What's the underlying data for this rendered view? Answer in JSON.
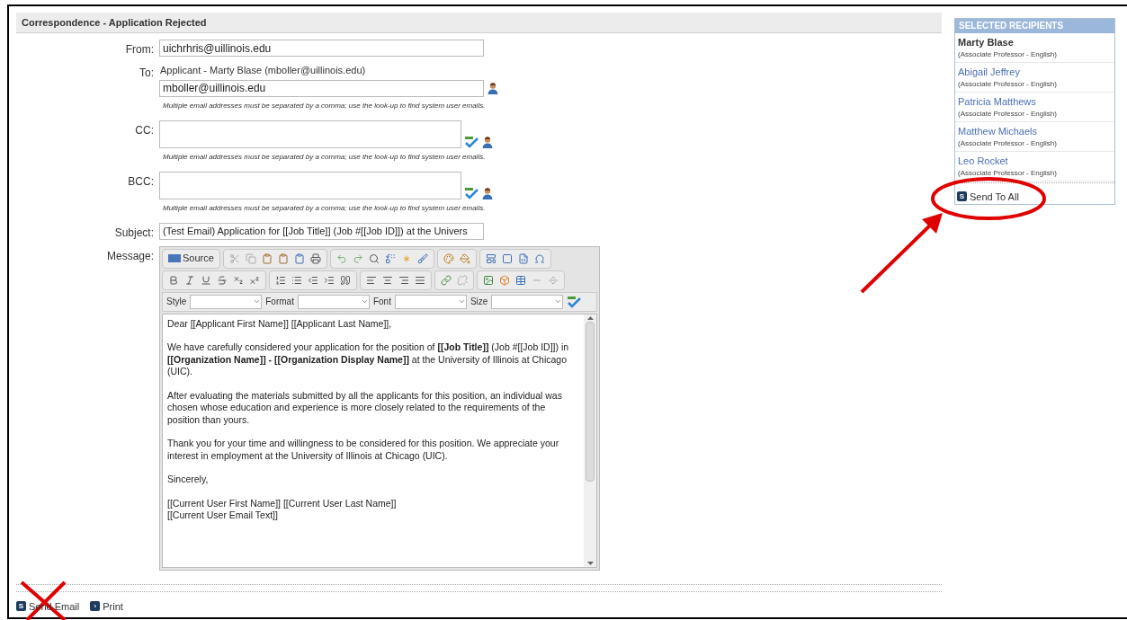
{
  "panel_title": "Correspondence - Application Rejected",
  "form": {
    "from": {
      "label": "From:",
      "value": "uichrhris@uillinois.edu"
    },
    "to": {
      "label": "To:",
      "recipient": "Applicant - Marty Blase (mboller@uillinois.edu)",
      "value": "mboller@uillinois.edu",
      "hint": "Multiple email addresses must be separated by a comma; use the look-up to find system user emails."
    },
    "cc": {
      "label": "CC:",
      "hint": "Multiple email addresses must be separated by a comma; use the look-up to find system user emails."
    },
    "bcc": {
      "label": "BCC:",
      "hint": "Multiple email addresses must be separated by a comma; use the look-up to find system user emails."
    },
    "subject": {
      "label": "Subject:",
      "value": "(Test Email) Application for [[Job Title]] (Job #[[Job ID]]) at the Univers"
    },
    "message_label": "Message:"
  },
  "editor": {
    "source_label": "Source",
    "combos": [
      {
        "label": "Style"
      },
      {
        "label": "Format"
      },
      {
        "label": "Font"
      },
      {
        "label": "Size"
      }
    ],
    "paragraphs": [
      "Dear [[Applicant First Name]] [[Applicant Last Name]],",
      "We have carefully considered your application for the position of **[[Job Title]]** (Job #[[Job ID]]) in **[[Organization Name]] - [[Organization Display Name]]** at the University of Illinois at Chicago (UIC).",
      "After evaluating the materials submitted by all the applicants for this position, an individual was chosen whose education and experience is more closely related to the requirements of the position than yours.",
      "Thank you for your time and willingness to be considered for this position. We appreciate your interest in employment at the University of Illinois at Chicago (UIC).",
      "Sincerely,",
      "[[Current User First Name]] [[Current User Last Name]]\n[[Current User Email Text]]"
    ]
  },
  "footer_actions": [
    {
      "label": "Send Email",
      "icon": "S"
    },
    {
      "label": "Print",
      "icon": "›"
    }
  ],
  "recipients": {
    "title": "SELECTED RECIPIENTS",
    "items": [
      {
        "name": "Marty Blase",
        "role": "(Associate Professor - English)",
        "selected": true
      },
      {
        "name": "Abigail Jeffrey",
        "role": "(Associate Professor - English)",
        "selected": false
      },
      {
        "name": "Patricia Matthews",
        "role": "(Associate Professor - English)",
        "selected": false
      },
      {
        "name": "Matthew Michaels",
        "role": "(Associate Professor - English)",
        "selected": false
      },
      {
        "name": "Leo Rocket",
        "role": "(Associate Professor - English)",
        "selected": false
      }
    ],
    "send_all": {
      "label": "Send To All",
      "icon": "S"
    }
  }
}
